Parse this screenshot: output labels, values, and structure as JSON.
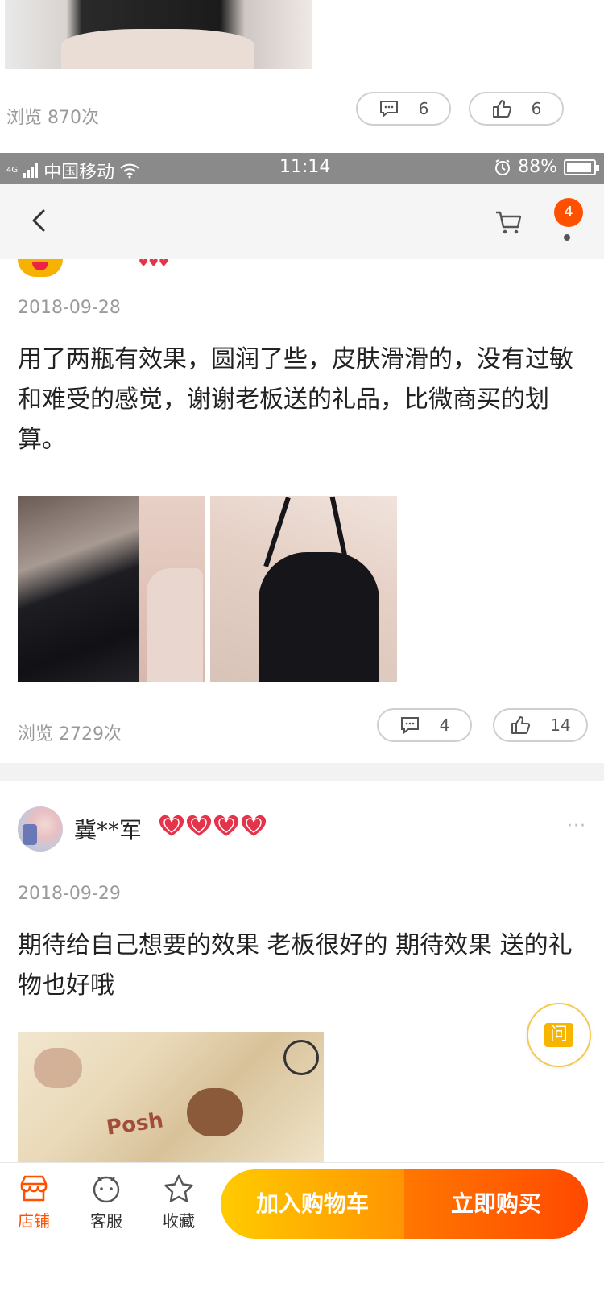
{
  "previous_review": {
    "views": "浏览 870次",
    "comment_count": "6",
    "like_count": "6"
  },
  "statusbar": {
    "network": "4G",
    "carrier": "中国移动",
    "time": "11:14",
    "battery": "88%"
  },
  "navbar": {
    "cart_badge": "4"
  },
  "review1": {
    "date": "2018-09-28",
    "content": "用了两瓶有效果，圆润了些，皮肤滑滑的，没有过敏和难受的感觉，谢谢老板送的礼品，比微商买的划算。",
    "views": "浏览 2729次",
    "comment_count": "4",
    "like_count": "14"
  },
  "review2": {
    "username": "冀**军",
    "date": "2018-09-29",
    "content": "期待给自己想要的效果 老板很好的 期待效果 送的礼物也好哦",
    "photo_text": "Posh",
    "more": "···"
  },
  "ask_button": {
    "label": "问"
  },
  "bottombar": {
    "store": "店铺",
    "service": "客服",
    "favorite": "收藏",
    "add_to_cart": "加入购物车",
    "buy_now": "立即购买"
  },
  "colors": {
    "accent": "#ff5000",
    "cart_button": "#ffb300",
    "buy_button": "#ff5a00",
    "heart": "#e5334b"
  }
}
